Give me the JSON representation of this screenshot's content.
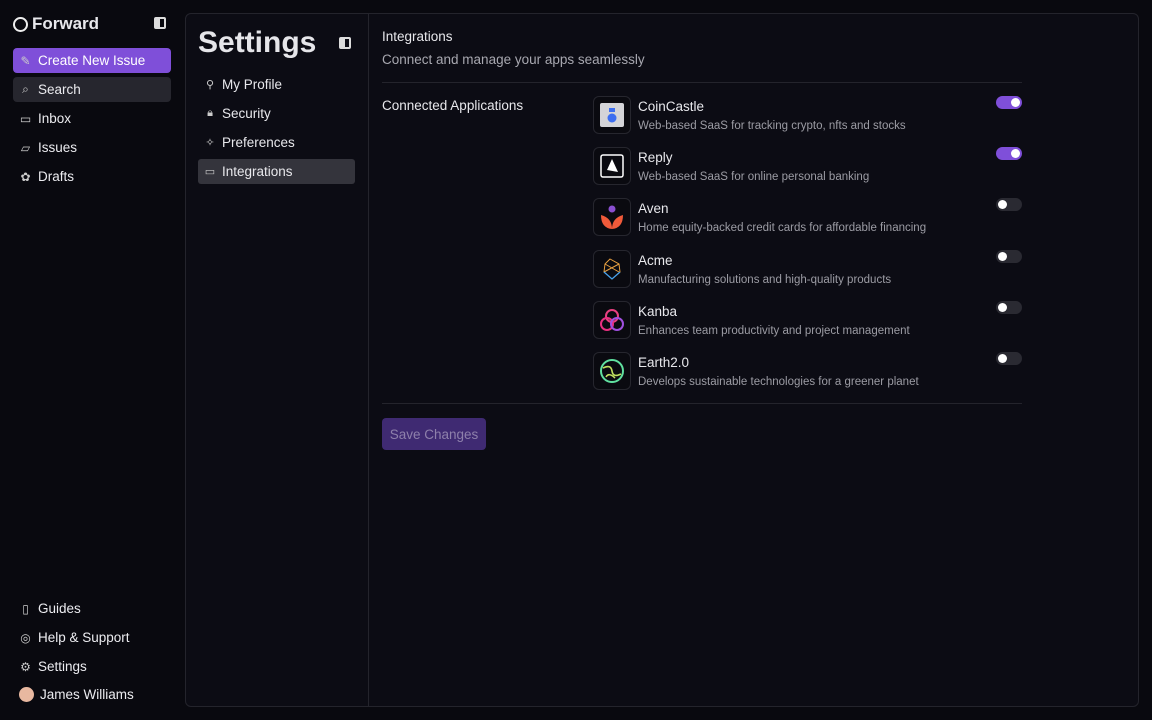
{
  "sidebar": {
    "brand": "Forward",
    "create": "Create New Issue",
    "search": "Search",
    "items": [
      {
        "label": "Inbox",
        "icon": "inbox-icon"
      },
      {
        "label": "Issues",
        "icon": "folder-icon"
      },
      {
        "label": "Drafts",
        "icon": "brain-icon"
      }
    ],
    "bottom": [
      {
        "label": "Guides",
        "icon": "file-icon"
      },
      {
        "label": "Help & Support",
        "icon": "lifebuoy-icon"
      },
      {
        "label": "Settings",
        "icon": "gear-icon"
      }
    ],
    "user": "James Williams"
  },
  "settings": {
    "title": "Settings",
    "items": [
      {
        "label": "My Profile",
        "icon": "user-icon"
      },
      {
        "label": "Security",
        "icon": "lock-icon"
      },
      {
        "label": "Preferences",
        "icon": "sparkles-icon"
      },
      {
        "label": "Integrations",
        "icon": "monitor-icon",
        "active": true
      }
    ]
  },
  "integrations": {
    "title": "Integrations",
    "subtitle": "Connect and manage your apps seamlessly",
    "section_label": "Connected Applications",
    "save": "Save Changes",
    "apps": [
      {
        "name": "CoinCastle",
        "desc": "Web-based SaaS for tracking crypto, nfts and stocks",
        "enabled": true
      },
      {
        "name": "Reply",
        "desc": "Web-based SaaS for online personal banking",
        "enabled": true
      },
      {
        "name": "Aven",
        "desc": "Home equity-backed credit cards for affordable financing",
        "enabled": false
      },
      {
        "name": "Acme",
        "desc": "Manufacturing solutions and high-quality products",
        "enabled": false
      },
      {
        "name": "Kanba",
        "desc": "Enhances team productivity and project management",
        "enabled": false
      },
      {
        "name": "Earth2.0",
        "desc": "Develops sustainable technologies for a greener planet",
        "enabled": false
      }
    ]
  },
  "colors": {
    "accent": "#7f4fd9"
  }
}
